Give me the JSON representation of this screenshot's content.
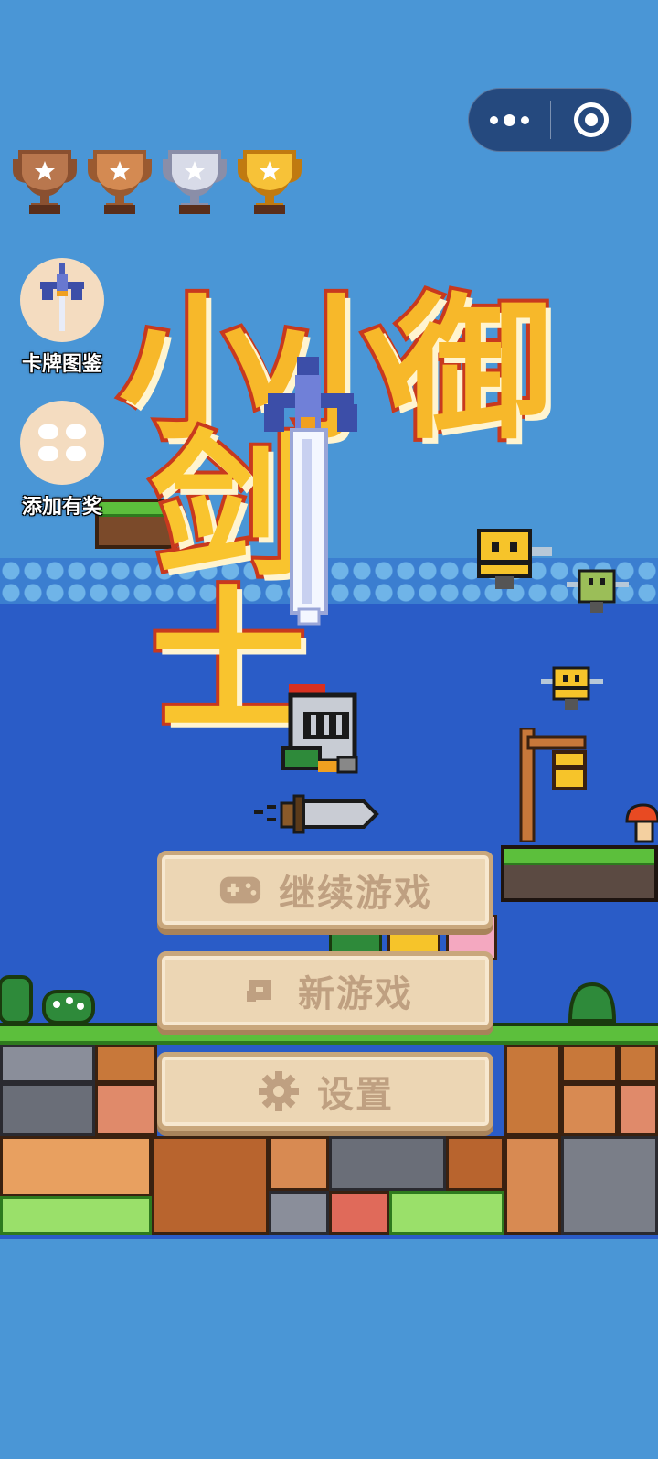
{
  "capsule": {
    "more_icon": "more-dots-icon",
    "close_icon": "target-icon"
  },
  "trophies": [
    {
      "tier": "bronze",
      "color": "#b9774e"
    },
    {
      "tier": "bronze",
      "color": "#c98550"
    },
    {
      "tier": "silver",
      "color": "#c9ccd8"
    },
    {
      "tier": "gold",
      "color": "#f0b52a"
    }
  ],
  "side_buttons": {
    "card_gallery": {
      "label": "卡牌图鉴",
      "icon": "sword-icon"
    },
    "add_reward": {
      "label": "添加有奖",
      "icon": "grid-icon"
    }
  },
  "title": {
    "line1": "小小御",
    "line2": "剑士"
  },
  "menu": {
    "continue": {
      "label": "继续游戏",
      "icon": "gamepad-icon"
    },
    "new_game": {
      "label": "新游戏",
      "icon": "refresh-icon"
    },
    "settings": {
      "label": "设置",
      "icon": "gear-icon"
    }
  },
  "colors": {
    "sky": "#4a96d6",
    "deep": "#2a5cc7",
    "button_bg": "#ecd6b4",
    "button_text": "#bfa081"
  }
}
